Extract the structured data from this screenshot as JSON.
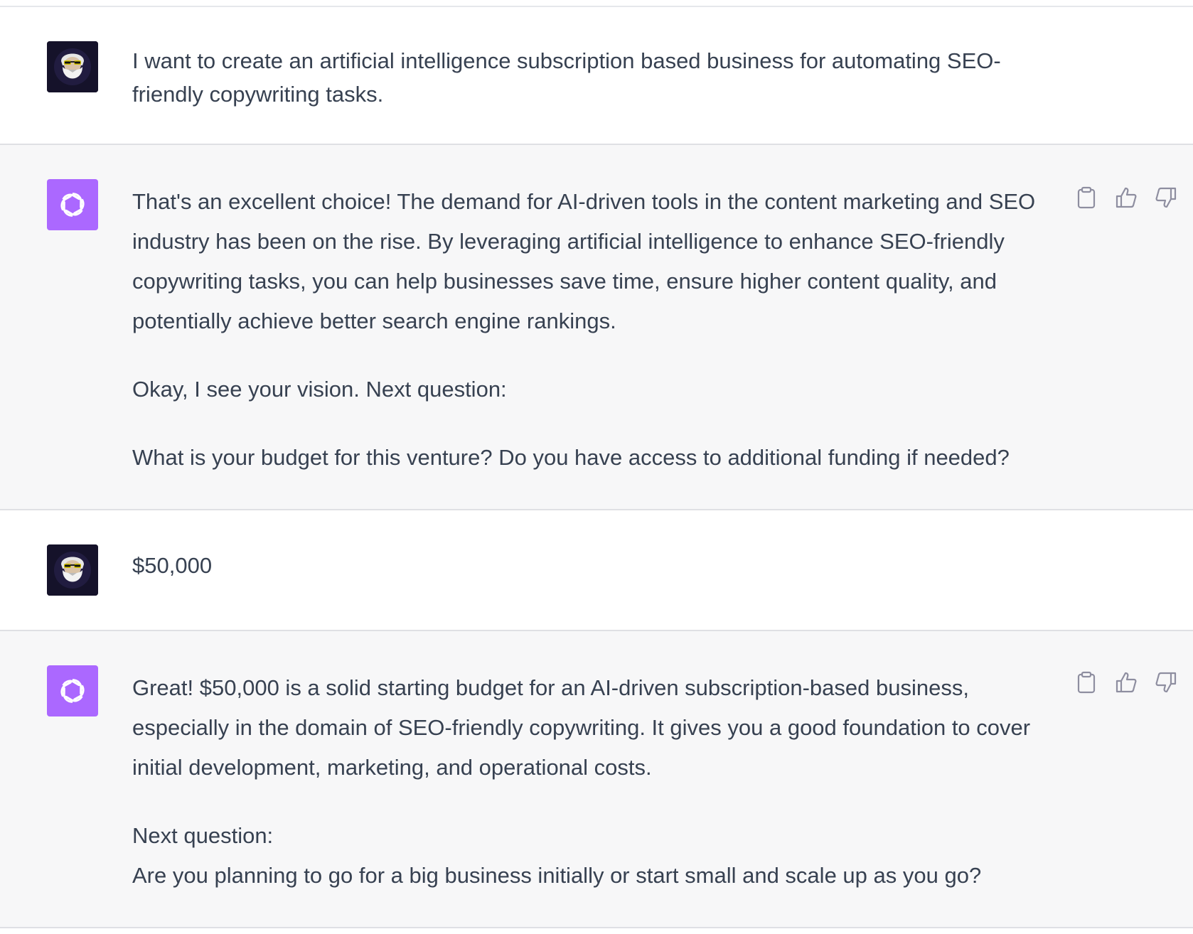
{
  "conversation": {
    "messages": [
      {
        "role": "user",
        "avatar_icon": "user-avatar-bearded-man-sunglasses",
        "text": "I want to create an artificial intelligence subscription based business for automating SEO-friendly copywriting tasks."
      },
      {
        "role": "assistant",
        "avatar_icon": "openai-logo-icon",
        "paragraphs": [
          "That's an excellent choice! The demand for AI-driven tools in the content marketing and SEO industry has been on the rise. By leveraging artificial intelligence to enhance SEO-friendly copywriting tasks, you can help businesses save time, ensure higher content quality, and potentially achieve better search engine rankings.",
          "Okay, I see your vision. Next question:",
          "What is your budget for this venture? Do you have access to additional funding if needed?"
        ],
        "actions": [
          "clipboard-icon",
          "thumbs-up-icon",
          "thumbs-down-icon"
        ]
      },
      {
        "role": "user",
        "avatar_icon": "user-avatar-bearded-man-sunglasses",
        "text": "$50,000"
      },
      {
        "role": "assistant",
        "avatar_icon": "openai-logo-icon",
        "paragraphs": [
          "Great! $50,000 is a solid starting budget for an AI-driven subscription-based business, especially in the domain of SEO-friendly copywriting. It gives you a good foundation to cover initial development, marketing, and operational costs.",
          "Next question:",
          "Are you planning to go for a big business initially or start small and scale up as you go?"
        ],
        "actions": [
          "clipboard-icon",
          "thumbs-up-icon",
          "thumbs-down-icon"
        ]
      }
    ]
  },
  "colors": {
    "user_bg": "#ffffff",
    "assistant_bg": "#f7f7f8",
    "assistant_avatar": "#ab68ff",
    "text": "#374151",
    "icon": "#8e8ea0"
  }
}
